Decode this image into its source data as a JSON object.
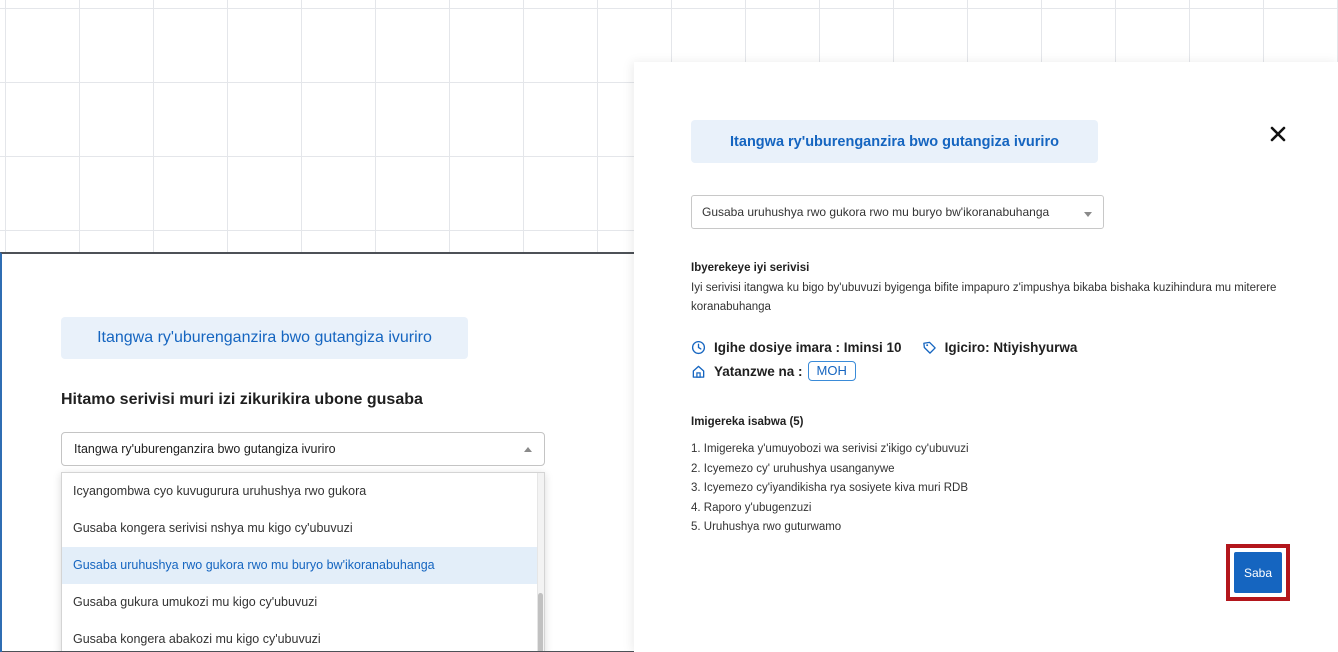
{
  "left_panel": {
    "title": "Itangwa ry'uburenganzira bwo gutangiza ivuriro",
    "heading": "Hitamo serivisi muri izi zikurikira ubone gusaba",
    "select_value": "Itangwa ry'uburenganzira bwo gutangiza ivuriro",
    "dropdown_options": [
      "Icyangombwa cyo kuvugurura uruhushya rwo gukora",
      "Gusaba kongera serivisi nshya mu kigo cy'ubuvuzi",
      "Gusaba uruhushya rwo gukora rwo mu buryo bw'ikoranabuhanga",
      "Gusaba gukura umukozi mu kigo cy'ubuvuzi",
      "Gusaba kongera abakozi mu kigo cy'ubuvuzi"
    ],
    "selected_option_index": 2
  },
  "right_panel": {
    "title": "Itangwa ry'uburenganzira bwo gutangiza ivuriro",
    "close_icon": "close-icon",
    "select_value": "Gusaba uruhushya rwo gukora rwo mu buryo bw'ikoranabuhanga",
    "description_label": "Ibyerekeye iyi serivisi",
    "description_text": "Iyi serivisi itangwa ku bigo by'ubuvuzi byigenga bifite impapuro z'impushya bikaba bishaka kuzihindura mu miterere koranabuhanga",
    "duration": "Igihe dosiye imara : Iminsi 10",
    "price": "Igiciro: Ntiyishyurwa",
    "provider_label": "Yatanzwe na :",
    "provider_tag": "MOH",
    "requirements_label": "Imigereka isabwa (5)",
    "requirements": [
      "1. Imigereka y'umuyobozi wa serivisi z'ikigo cy'ubuvuzi",
      "2. Icyemezo cy' uruhushya usanganywe",
      "3. Icyemezo cy'iyandikisha rya sosiyete kiva muri RDB",
      "4. Raporo y'ubugenzuzi",
      "5. Uruhushya rwo guturwamo"
    ],
    "submit_label": "Saba"
  },
  "colors": {
    "accent": "#1565c0",
    "title_bg": "#e9f1fa",
    "selected_bg": "#e3eef9",
    "highlight_border": "#b3161c"
  }
}
